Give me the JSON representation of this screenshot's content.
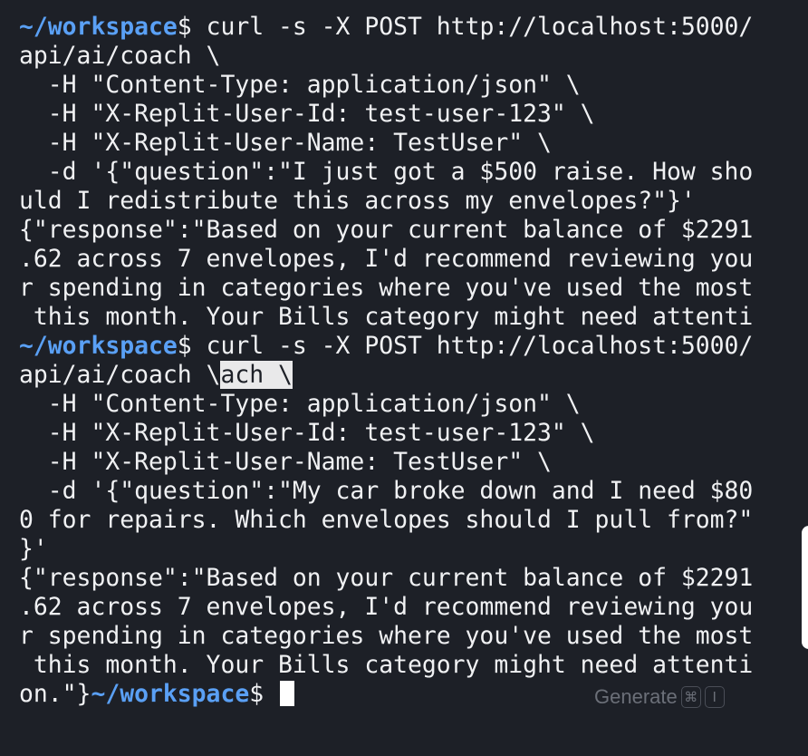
{
  "terminal": {
    "prompt_path": "~/workspace",
    "prompt_symbol": "$ ",
    "block1": {
      "cmd1": "curl -s -X POST http://localhost:5000/",
      "cmd2": "api/ai/coach \\",
      "h1": "  -H \"Content-Type: application/json\" \\",
      "h2": "  -H \"X-Replit-User-Id: test-user-123\" \\",
      "h3": "  -H \"X-Replit-User-Name: TestUser\" \\",
      "d1": "  -d '{\"question\":\"I just got a $500 raise. How sho",
      "d2": "uld I redistribute this across my envelopes?\"}'",
      "r1": "{\"response\":\"Based on your current balance of $2291",
      "r2": ".62 across 7 envelopes, I'd recommend reviewing you",
      "r3": "r spending in categories where you've used the most",
      "r4": " this month. Your Bills category might need attenti"
    },
    "block2": {
      "cmd1": "curl -s -X POST http://localhost:5000/",
      "cmd2": "api/ai/coach \\",
      "cmd2_selected": "ach \\",
      "h1": "  -H \"Content-Type: application/json\" \\",
      "h2": "  -H \"X-Replit-User-Id: test-user-123\" \\",
      "h3": "  -H \"X-Replit-User-Name: TestUser\" \\",
      "d1": "  -d '{\"question\":\"My car broke down and I need $80",
      "d2": "0 for repairs. Which envelopes should I pull from?\"",
      "d3": "}'",
      "r1": "{\"response\":\"Based on your current balance of $2291",
      "r2": ".62 across 7 envelopes, I'd recommend reviewing you",
      "r3": "r spending in categories where you've used the most",
      "r4": " this month. Your Bills category might need attenti",
      "r5": "on.\"}"
    },
    "final_prompt_path": "~/workspace",
    "final_prompt_symbol": "$ "
  },
  "generate_hint": {
    "label": "Generate",
    "key1": "⌘",
    "key2": "I"
  },
  "colors": {
    "background": "#1d2027",
    "text": "#f0f1f3",
    "prompt": "#5aa0f5",
    "hint": "#6b6f78"
  }
}
